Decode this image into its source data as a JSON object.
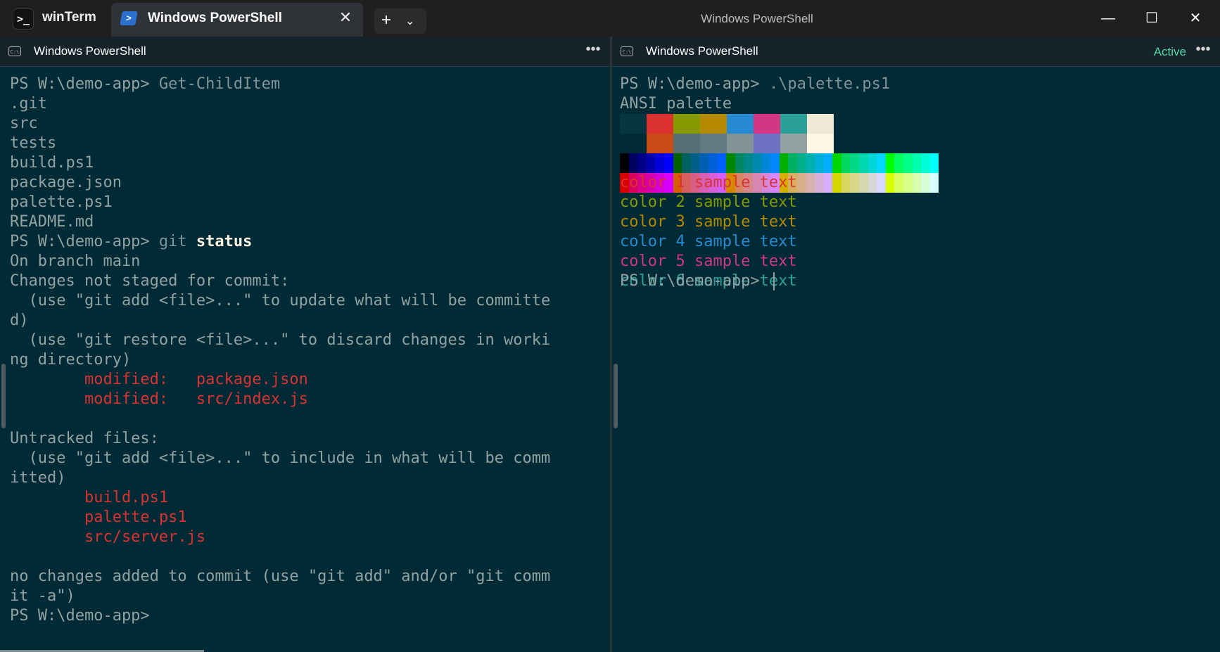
{
  "app": {
    "name": "winTerm",
    "icon": "terminal-icon"
  },
  "tab": {
    "label": "Windows PowerShell",
    "icon": "powershell-icon",
    "close": "✕"
  },
  "toolbar": {
    "new_tab": "+",
    "dropdown": "⌄"
  },
  "window": {
    "title": "Windows PowerShell",
    "minimize": "—",
    "maximize": "☐",
    "close": "✕"
  },
  "left_pane": {
    "title": "Windows PowerShell",
    "icon": "console-icon",
    "more": "•••",
    "lines": [
      {
        "segments": [
          {
            "text": "PS W:\\demo-app> ",
            "cls": ""
          },
          {
            "text": "Get-ChildItem",
            "cls": "dim"
          }
        ]
      },
      {
        "segments": [
          {
            "text": ".git",
            "cls": ""
          }
        ]
      },
      {
        "segments": [
          {
            "text": "src",
            "cls": ""
          }
        ]
      },
      {
        "segments": [
          {
            "text": "tests",
            "cls": ""
          }
        ]
      },
      {
        "segments": [
          {
            "text": "build.ps1",
            "cls": ""
          }
        ]
      },
      {
        "segments": [
          {
            "text": "package.json",
            "cls": ""
          }
        ]
      },
      {
        "segments": [
          {
            "text": "palette.ps1",
            "cls": ""
          }
        ]
      },
      {
        "segments": [
          {
            "text": "README.md",
            "cls": ""
          }
        ]
      },
      {
        "segments": [
          {
            "text": "PS W:\\demo-app> ",
            "cls": ""
          },
          {
            "text": "git ",
            "cls": "dim"
          },
          {
            "text": "status",
            "cls": "b"
          }
        ]
      },
      {
        "segments": [
          {
            "text": "On branch main",
            "cls": ""
          }
        ]
      },
      {
        "segments": [
          {
            "text": "Changes not staged for commit:",
            "cls": ""
          }
        ]
      },
      {
        "segments": [
          {
            "text": "  (use \"git add <file>...\" to update what will be committe",
            "cls": ""
          }
        ]
      },
      {
        "segments": [
          {
            "text": "d)",
            "cls": ""
          }
        ]
      },
      {
        "segments": [
          {
            "text": "  (use \"git restore <file>...\" to discard changes in worki",
            "cls": ""
          }
        ]
      },
      {
        "segments": [
          {
            "text": "ng directory)",
            "cls": ""
          }
        ]
      },
      {
        "segments": [
          {
            "text": "        modified:   package.json",
            "cls": "red"
          }
        ]
      },
      {
        "segments": [
          {
            "text": "        modified:   src/index.js",
            "cls": "red"
          }
        ]
      },
      {
        "segments": [
          {
            "text": " ",
            "cls": ""
          }
        ]
      },
      {
        "segments": [
          {
            "text": "Untracked files:",
            "cls": ""
          }
        ]
      },
      {
        "segments": [
          {
            "text": "  (use \"git add <file>...\" to include in what will be comm",
            "cls": ""
          }
        ]
      },
      {
        "segments": [
          {
            "text": "itted)",
            "cls": ""
          }
        ]
      },
      {
        "segments": [
          {
            "text": "        build.ps1",
            "cls": "red"
          }
        ]
      },
      {
        "segments": [
          {
            "text": "        palette.ps1",
            "cls": "red"
          }
        ]
      },
      {
        "segments": [
          {
            "text": "        src/server.js",
            "cls": "red"
          }
        ]
      },
      {
        "segments": [
          {
            "text": " ",
            "cls": ""
          }
        ]
      },
      {
        "segments": [
          {
            "text": "no changes added to commit (use \"git add\" and/or \"git comm",
            "cls": ""
          }
        ]
      },
      {
        "segments": [
          {
            "text": "it -a\")",
            "cls": ""
          }
        ]
      },
      {
        "segments": [
          {
            "text": "PS W:\\demo-app>",
            "cls": ""
          }
        ]
      }
    ]
  },
  "right_pane": {
    "title": "Windows PowerShell",
    "icon": "console-icon",
    "status": "Active",
    "more": "•••",
    "prompt_line": {
      "prompt": "PS W:\\demo-app> ",
      "command": ".\\palette.ps1"
    },
    "palette_title": "ANSI palette",
    "ansi_rows": [
      [
        "#073642",
        "#dc322f",
        "#859900",
        "#b58900",
        "#268bd2",
        "#d33682",
        "#2aa198",
        "#eee8d5"
      ],
      [
        "#002b36",
        "#cb4b16",
        "#586e75",
        "#657b83",
        "#839496",
        "#6c71c4",
        "#93a1a1",
        "#fdf6e3"
      ]
    ],
    "spectrum_rows": [
      [
        "#000000",
        "#00005f",
        "#000087",
        "#0000af",
        "#0000d7",
        "#0000ff",
        "#005f00",
        "#005f5f",
        "#005f87",
        "#005faf",
        "#005fd7",
        "#005fff",
        "#008700",
        "#00875f",
        "#008787",
        "#0087af",
        "#0087d7",
        "#0087ff",
        "#00af00",
        "#00af5f",
        "#00af87",
        "#00afaf",
        "#00afd7",
        "#00afff",
        "#00d700",
        "#00d75f",
        "#00d787",
        "#00d7af",
        "#00d7d7",
        "#00d7ff",
        "#00ff00",
        "#00ff5f",
        "#00ff87",
        "#00ffaf",
        "#00ffd7",
        "#00ffff"
      ],
      [
        "#d70000",
        "#d7005f",
        "#d70087",
        "#d700af",
        "#d700d7",
        "#d700ff",
        "#d75f00",
        "#d75f5f",
        "#d75f87",
        "#d75faf",
        "#d75fd7",
        "#d75fff",
        "#d78700",
        "#d7875f",
        "#d78787",
        "#d787af",
        "#d787d7",
        "#d787ff",
        "#d7af00",
        "#d7af5f",
        "#d7af87",
        "#d7afaf",
        "#d7afd7",
        "#d7afff",
        "#d7d700",
        "#d7d75f",
        "#d7d787",
        "#d7d7af",
        "#d7d7d7",
        "#d7d7ff",
        "#d7ff00",
        "#d7ff5f",
        "#d7ff87",
        "#d7ffaf",
        "#d7ffd7",
        "#d7ffff"
      ]
    ],
    "samples": [
      {
        "text": "color 1 sample text",
        "color": "#dc322f"
      },
      {
        "text": "color 2 sample text",
        "color": "#859900"
      },
      {
        "text": "color 3 sample text",
        "color": "#b58900"
      },
      {
        "text": "color 4 sample text",
        "color": "#268bd2"
      },
      {
        "text": "color 5 sample text",
        "color": "#d33682"
      },
      {
        "text": "color 6 sample text",
        "color": "#2aa198"
      }
    ],
    "final_prompt": "PS W:\\demo-app> "
  },
  "colors": {
    "background": "#002b36",
    "foreground": "#93a1a1",
    "active": "#4fd6a6"
  }
}
